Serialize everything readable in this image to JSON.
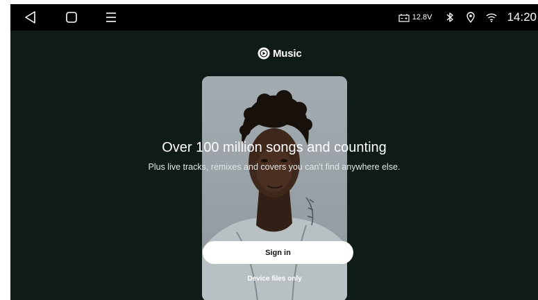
{
  "status_bar": {
    "battery_voltage": "12.8V",
    "clock": "14:20",
    "icons": [
      "back-icon",
      "home-icon",
      "menu-icon",
      "battery-icon",
      "bluetooth-icon",
      "location-icon",
      "wifi-icon"
    ]
  },
  "app": {
    "logo_text": "Music",
    "headline": "Over 100 million songs and counting",
    "subline": "Plus live tracks, remixes and covers you can't find anywhere else.",
    "sign_in_label": "Sign in",
    "device_files_label": "Device files only"
  },
  "colors": {
    "background": "#0f1b17",
    "status_bar": "#000000",
    "button_bg": "#ffffff",
    "logo_red": "#ffffff"
  }
}
